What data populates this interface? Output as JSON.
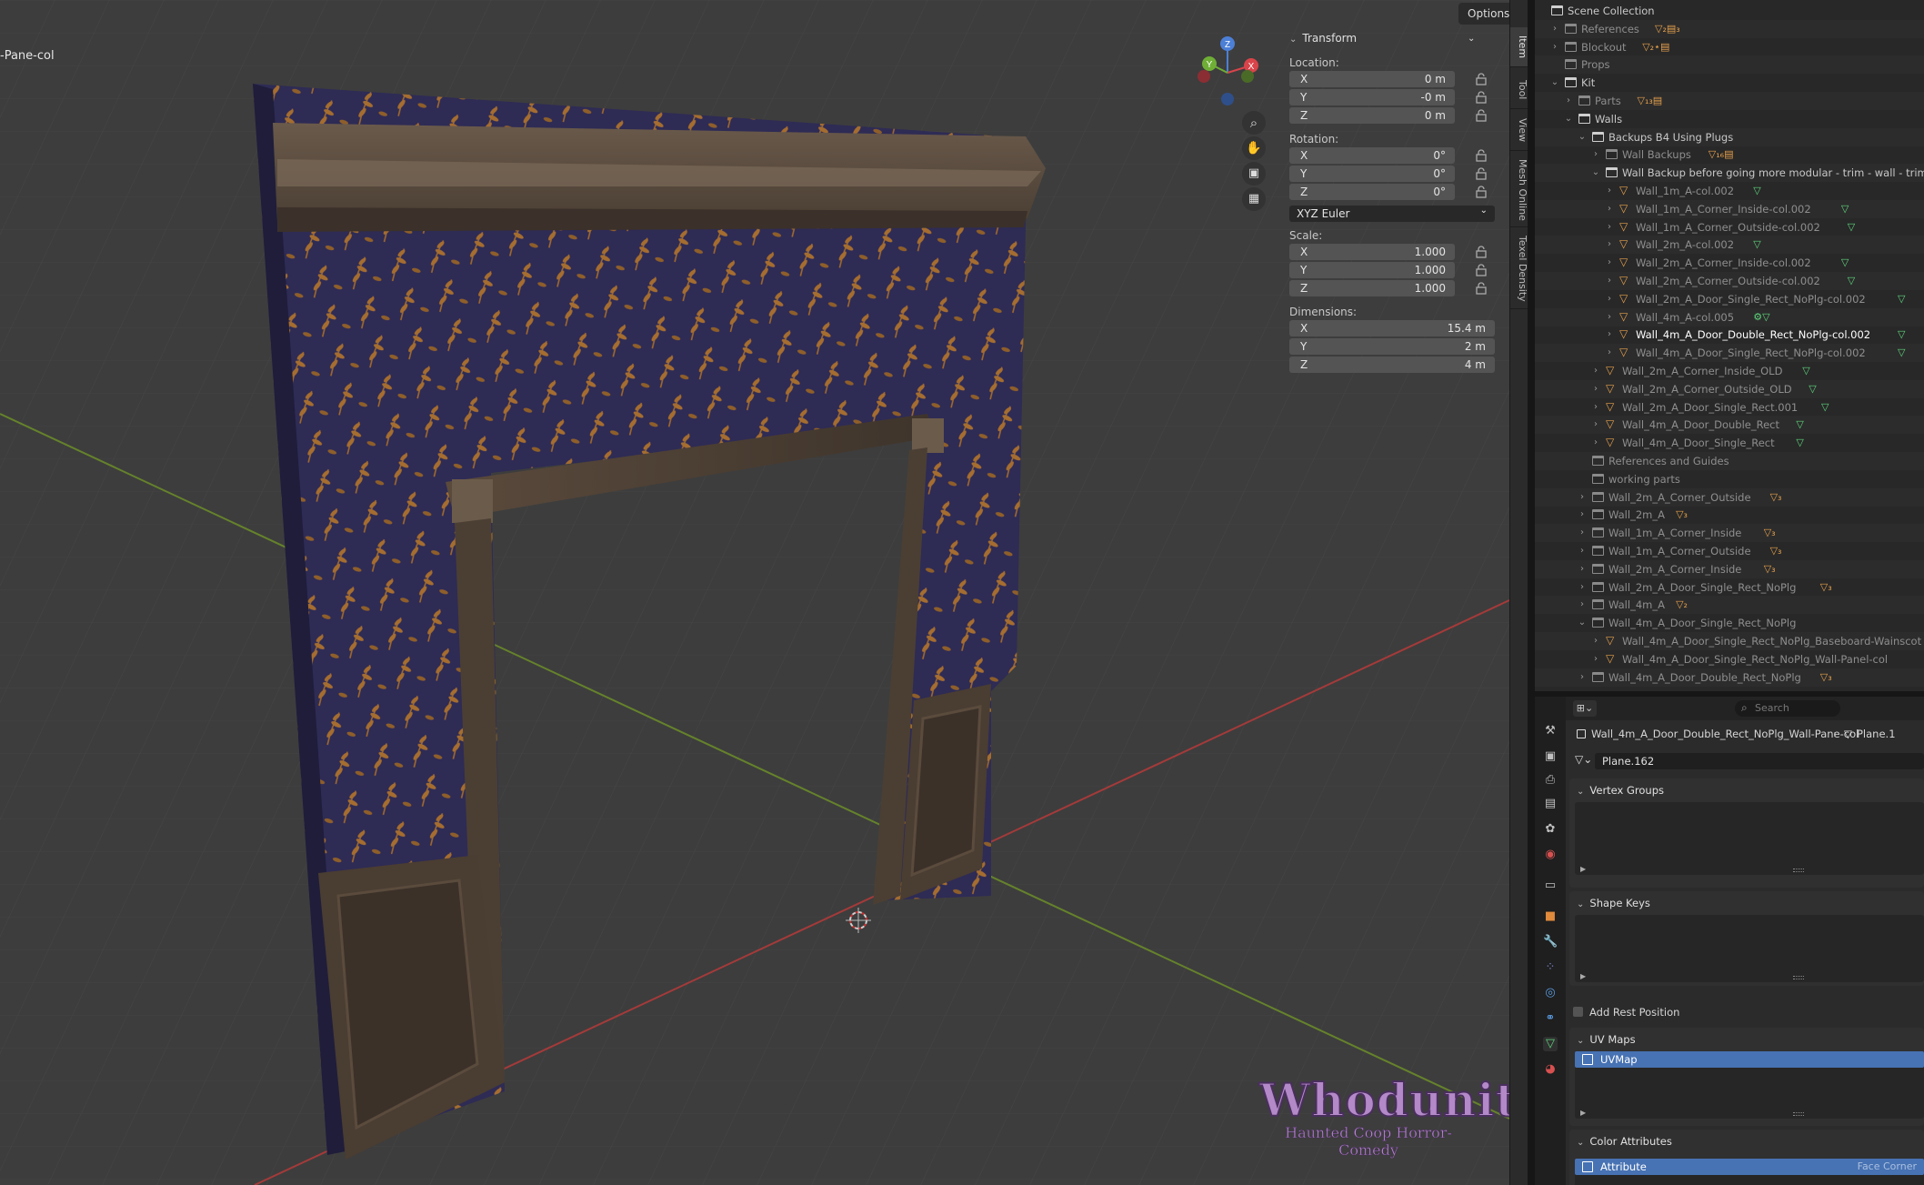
{
  "viewport": {
    "object_name_overlay": "-Pane-col",
    "options_label": "Options",
    "gizmo": {
      "z": "Z",
      "y": "Y",
      "x": "X"
    },
    "watermark": {
      "title": "Whodunit?",
      "subtitle": "Haunted Coop Horror-Comedy"
    }
  },
  "npanel": {
    "header": "Transform",
    "location_label": "Location:",
    "location": [
      {
        "axis": "X",
        "value": "0 m"
      },
      {
        "axis": "Y",
        "value": "-0 m"
      },
      {
        "axis": "Z",
        "value": "0 m"
      }
    ],
    "rotation_label": "Rotation:",
    "rotation": [
      {
        "axis": "X",
        "value": "0°"
      },
      {
        "axis": "Y",
        "value": "0°"
      },
      {
        "axis": "Z",
        "value": "0°"
      }
    ],
    "rotation_mode": "XYZ Euler",
    "scale_label": "Scale:",
    "scale": [
      {
        "axis": "X",
        "value": "1.000"
      },
      {
        "axis": "Y",
        "value": "1.000"
      },
      {
        "axis": "Z",
        "value": "1.000"
      }
    ],
    "dimensions_label": "Dimensions:",
    "dimensions": [
      {
        "axis": "X",
        "value": "15.4 m"
      },
      {
        "axis": "Y",
        "value": "2 m"
      },
      {
        "axis": "Z",
        "value": "4 m"
      }
    ]
  },
  "vtabs": [
    "Item",
    "Tool",
    "View",
    "Mesh Online",
    "Texel Density"
  ],
  "outliner": {
    "rows": [
      {
        "indent": 0,
        "chev": "",
        "icon": "coll",
        "text": "Scene Collection",
        "badge": ""
      },
      {
        "indent": 1,
        "chev": "›",
        "icon": "coll",
        "text": "References",
        "badge": "▽₂▤₃",
        "dim": true
      },
      {
        "indent": 1,
        "chev": "›",
        "icon": "coll",
        "text": "Blockout",
        "badge": "▽₂⋆▤",
        "dim": true
      },
      {
        "indent": 1,
        "chev": "",
        "icon": "coll",
        "text": "Props",
        "badge": "",
        "dim": true
      },
      {
        "indent": 1,
        "chev": "⌄",
        "icon": "coll",
        "text": "Kit",
        "badge": ""
      },
      {
        "indent": 2,
        "chev": "›",
        "icon": "coll",
        "text": "Parts",
        "badge": "▽₁₃▤",
        "dim": true
      },
      {
        "indent": 2,
        "chev": "⌄",
        "icon": "coll",
        "text": "Walls",
        "badge": ""
      },
      {
        "indent": 3,
        "chev": "⌄",
        "icon": "coll",
        "text": "Backups B4 Using Plugs",
        "badge": ""
      },
      {
        "indent": 4,
        "chev": "›",
        "icon": "coll",
        "text": "Wall Backups",
        "badge": "▽₁₆▤",
        "dim": true
      },
      {
        "indent": 4,
        "chev": "⌄",
        "icon": "coll",
        "text": "Wall Backup before going more modular - trim - wall - trim",
        "badge": ""
      },
      {
        "indent": 5,
        "chev": "›",
        "icon": "obj",
        "text": "Wall_1m_A-col.002",
        "badge": "▽",
        "dim": true
      },
      {
        "indent": 5,
        "chev": "›",
        "icon": "obj",
        "text": "Wall_1m_A_Corner_Inside-col.002",
        "badge": "▽",
        "dim": true
      },
      {
        "indent": 5,
        "chev": "›",
        "icon": "obj",
        "text": "Wall_1m_A_Corner_Outside-col.002",
        "badge": "▽",
        "dim": true
      },
      {
        "indent": 5,
        "chev": "›",
        "icon": "obj",
        "text": "Wall_2m_A-col.002",
        "badge": "▽",
        "dim": true
      },
      {
        "indent": 5,
        "chev": "›",
        "icon": "obj",
        "text": "Wall_2m_A_Corner_Inside-col.002",
        "badge": "▽",
        "dim": true
      },
      {
        "indent": 5,
        "chev": "›",
        "icon": "obj",
        "text": "Wall_2m_A_Corner_Outside-col.002",
        "badge": "▽",
        "dim": true
      },
      {
        "indent": 5,
        "chev": "›",
        "icon": "obj",
        "text": "Wall_2m_A_Door_Single_Rect_NoPlg-col.002",
        "badge": "▽",
        "dim": true
      },
      {
        "indent": 5,
        "chev": "›",
        "icon": "obj",
        "text": "Wall_4m_A-col.005",
        "badge": "⚙▽",
        "dim": true
      },
      {
        "indent": 5,
        "chev": "›",
        "icon": "obj",
        "text": "Wall_4m_A_Door_Double_Rect_NoPlg-col.002",
        "badge": "▽",
        "hi": true
      },
      {
        "indent": 5,
        "chev": "›",
        "icon": "obj",
        "text": "Wall_4m_A_Door_Single_Rect_NoPlg-col.002",
        "badge": "▽",
        "dim": true
      },
      {
        "indent": 4,
        "chev": "›",
        "icon": "obj",
        "text": "Wall_2m_A_Corner_Inside_OLD",
        "badge": "▽",
        "dim": true
      },
      {
        "indent": 4,
        "chev": "›",
        "icon": "obj",
        "text": "Wall_2m_A_Corner_Outside_OLD",
        "badge": "▽",
        "dim": true
      },
      {
        "indent": 4,
        "chev": "›",
        "icon": "obj",
        "text": "Wall_2m_A_Door_Single_Rect.001",
        "badge": "▽",
        "dim": true
      },
      {
        "indent": 4,
        "chev": "›",
        "icon": "obj",
        "text": "Wall_4m_A_Door_Double_Rect",
        "badge": "▽",
        "dim": true
      },
      {
        "indent": 4,
        "chev": "›",
        "icon": "obj",
        "text": "Wall_4m_A_Door_Single_Rect",
        "badge": "▽",
        "dim": true
      },
      {
        "indent": 3,
        "chev": "",
        "icon": "coll",
        "text": "References and Guides",
        "badge": "",
        "dim": true
      },
      {
        "indent": 3,
        "chev": "",
        "icon": "coll",
        "text": "working parts",
        "badge": "",
        "dim": true
      },
      {
        "indent": 3,
        "chev": "›",
        "icon": "coll",
        "text": "Wall_2m_A_Corner_Outside",
        "badge": "▽₃",
        "dim": true
      },
      {
        "indent": 3,
        "chev": "›",
        "icon": "coll",
        "text": "Wall_2m_A",
        "badge": "▽₃",
        "dim": true
      },
      {
        "indent": 3,
        "chev": "›",
        "icon": "coll",
        "text": "Wall_1m_A_Corner_Inside",
        "badge": "▽₃",
        "dim": true
      },
      {
        "indent": 3,
        "chev": "›",
        "icon": "coll",
        "text": "Wall_1m_A_Corner_Outside",
        "badge": "▽₃",
        "dim": true
      },
      {
        "indent": 3,
        "chev": "›",
        "icon": "coll",
        "text": "Wall_2m_A_Corner_Inside",
        "badge": "▽₃",
        "dim": true
      },
      {
        "indent": 3,
        "chev": "›",
        "icon": "coll",
        "text": "Wall_2m_A_Door_Single_Rect_NoPlg",
        "badge": "▽₃",
        "dim": true
      },
      {
        "indent": 3,
        "chev": "›",
        "icon": "coll",
        "text": "Wall_4m_A",
        "badge": "▽₂",
        "dim": true
      },
      {
        "indent": 3,
        "chev": "⌄",
        "icon": "coll",
        "text": "Wall_4m_A_Door_Single_Rect_NoPlg",
        "badge": "",
        "dim": true
      },
      {
        "indent": 4,
        "chev": "›",
        "icon": "obj",
        "text": "Wall_4m_A_Door_Single_Rect_NoPlg_Baseboard-Wainscot",
        "badge": "",
        "dim": true
      },
      {
        "indent": 4,
        "chev": "›",
        "icon": "obj",
        "text": "Wall_4m_A_Door_Single_Rect_NoPlg_Wall-Panel-col",
        "badge": "",
        "dim": true
      },
      {
        "indent": 3,
        "chev": "›",
        "icon": "coll",
        "text": "Wall_4m_A_Door_Double_Rect_NoPlg",
        "badge": "▽₃",
        "dim": true
      }
    ]
  },
  "properties": {
    "search_placeholder": "Search",
    "object_name": "Wall_4m_A_Door_Double_Rect_NoPlg_Wall-Pane-col",
    "breadcrumb_sep": "›",
    "mesh_crumb": "Plane.1",
    "mesh_data": "Plane.162",
    "vertex_groups": "Vertex Groups",
    "shape_keys": "Shape Keys",
    "add_rest_position": "Add Rest Position",
    "uv_maps": "UV Maps",
    "uv_map_item": "UVMap",
    "color_attributes": "Color Attributes",
    "color_attr_item": "Attribute",
    "color_attr_domain": "Face Corner"
  }
}
